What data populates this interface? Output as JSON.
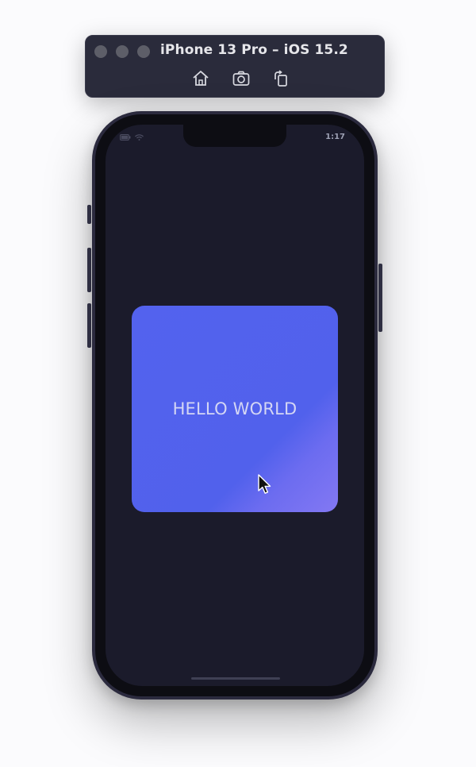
{
  "window": {
    "title": "iPhone 13 Pro – iOS 15.2",
    "toolbar": {
      "home_icon": "home-icon",
      "screenshot_icon": "camera-icon",
      "rotate_icon": "rotate-icon"
    }
  },
  "status_bar": {
    "left_icons": [
      "battery-icon",
      "wifi-icon"
    ],
    "time": "1:17"
  },
  "app": {
    "card_text": "HELLO WORLD",
    "colors": {
      "background": "#1b1b2b",
      "card": "#5362ee",
      "card_text": "#d4d6f4"
    }
  }
}
